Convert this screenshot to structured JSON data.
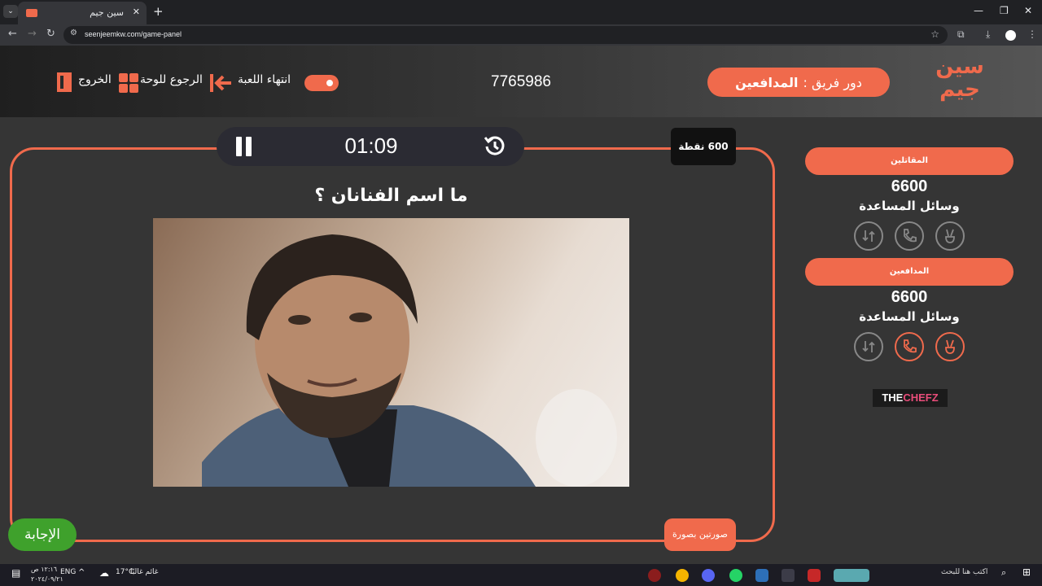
{
  "browser": {
    "tab_title": "سين جيم",
    "url": "seenjeemkw.com/game-panel"
  },
  "header": {
    "logo_text": "سين جيم",
    "team_turn_label": "دور فريق :",
    "team_turn_name": "المدافعين",
    "game_code": "7765986",
    "end_game_label": "انتهاء اللعبة",
    "back_to_board_label": "الرجوع للوحة",
    "exit_label": "الخروج"
  },
  "question": {
    "timer": "01:09",
    "points": "600 نقطة",
    "text": "ما اسم الفنانان ؟",
    "category": "صورتين بصورة",
    "answer_label": "الإجابة"
  },
  "teams": [
    {
      "name": "المقاتلين",
      "score": "6600",
      "aids_label": "وسائل المساعدة",
      "aids": [
        {
          "icon": "peace-icon",
          "active": false
        },
        {
          "icon": "phone-icon",
          "active": false
        },
        {
          "icon": "swap-icon",
          "active": false
        }
      ]
    },
    {
      "name": "المدافعين",
      "score": "6600",
      "aids_label": "وسائل المساعدة",
      "aids": [
        {
          "icon": "peace-icon",
          "active": true
        },
        {
          "icon": "phone-icon",
          "active": true
        },
        {
          "icon": "swap-icon",
          "active": false
        }
      ]
    }
  ],
  "sponsor": {
    "part1": "THE",
    "part2": "CHEFZ"
  },
  "taskbar": {
    "search_placeholder": "اكتب هنا للبحث",
    "weather": "17°C",
    "weather_desc": "غائم غالبًا",
    "lang": "ENG",
    "time": "١٢:١٦ ص",
    "date": "٢٠٢٤/٠٩/٢١"
  },
  "colors": {
    "accent": "#f06a4c",
    "answer": "#3fa12c",
    "background": "#353535"
  }
}
